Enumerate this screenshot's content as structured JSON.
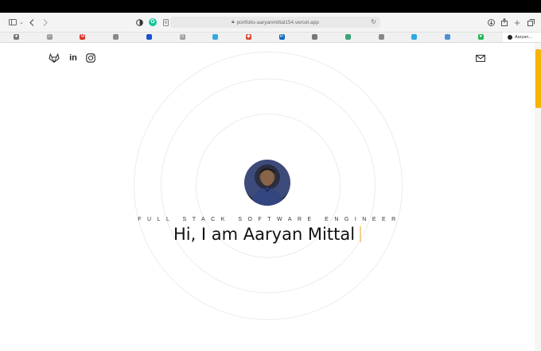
{
  "browser": {
    "url": "portfolio-aaryanmittal154.vercel.app",
    "active_tab_label": "Aaryan..."
  },
  "favorites": [
    {
      "icon": "apple-icon",
      "color": "#777777"
    },
    {
      "icon": "star-icon",
      "color": "#999999"
    },
    {
      "icon": "gmail-icon",
      "color": "#d93025"
    },
    {
      "icon": "globe-icon",
      "color": "#888888"
    },
    {
      "icon": "app-icon",
      "color": "#1a4fd6"
    },
    {
      "icon": "clock-icon",
      "color": "#999999"
    },
    {
      "icon": "circle-icon",
      "color": "#33aadd"
    },
    {
      "icon": "gitlab-icon",
      "color": "#e24329"
    },
    {
      "icon": "linkedin-icon",
      "color": "#0a66c2"
    },
    {
      "icon": "app-icon",
      "color": "#777777"
    },
    {
      "icon": "app-icon",
      "color": "#3aa675"
    },
    {
      "icon": "app-icon",
      "color": "#888888"
    },
    {
      "icon": "vercel-icon",
      "color": "#2aa9e0"
    },
    {
      "icon": "app-icon",
      "color": "#4a90d9"
    },
    {
      "icon": "spotify-icon",
      "color": "#1db954"
    }
  ],
  "socials": [
    "gitlab-icon",
    "linkedin-icon",
    "instagram-icon"
  ],
  "social_labels": {
    "linkedin": "in"
  },
  "hero": {
    "subtitle": "FULL STACK SOFTWARE ENGINEER",
    "headline": "Hi, I am Aaryan Mittal"
  },
  "colors": {
    "accent": "#f5b400",
    "caret": "#f0d28a"
  }
}
